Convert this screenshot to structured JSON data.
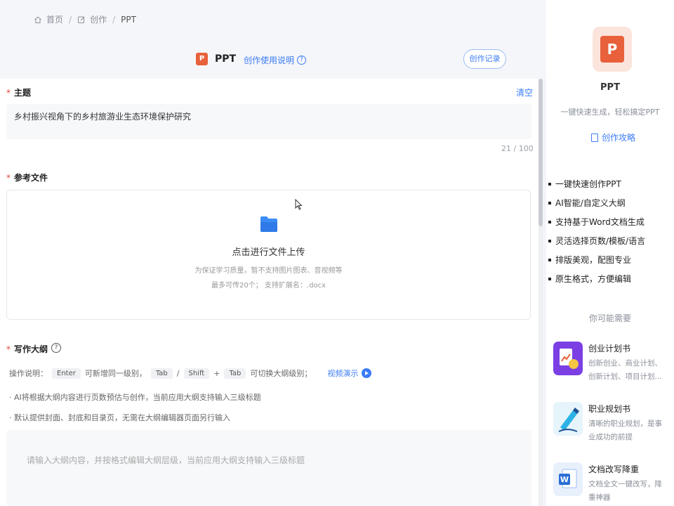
{
  "breadcrumb": {
    "home": "首页",
    "create": "创作",
    "current": "PPT"
  },
  "header": {
    "title": "PPT",
    "guide_link": "创作使用说明",
    "history_button": "创作记录"
  },
  "topic": {
    "label": "主题",
    "clear": "清空",
    "value": "乡村振兴视角下的乡村旅游业生态环境保护研究",
    "counter": "21 / 100"
  },
  "reference": {
    "label": "参考文件",
    "upload_title": "点击进行文件上传",
    "note1": "为保证学习质量，暂不支持图片图表、音视频等",
    "note2": "最多可传20个； 支持扩展名：.docx"
  },
  "outline": {
    "label": "写作大纲",
    "ops_label": "操作说明：",
    "key_enter": "Enter",
    "ops_text1": "可新增同一级别，",
    "key_tab": "Tab",
    "slash": "/",
    "key_shift": "Shift",
    "plus": "+",
    "key_tab2": "Tab",
    "ops_text2": "可切换大纲级别；",
    "video_link": "视频演示",
    "tip1": "· AI将根据大纲内容进行页数预估与创作，当前应用大纲支持输入三级标题",
    "tip2": "· 默认提供封面、封底和目录页，无需在大纲编辑器页面另行输入",
    "placeholder": "请输入大纲内容，并按格式编辑大纲层级，当前应用大纲支持输入三级标题"
  },
  "sidebar": {
    "title": "PPT",
    "subtitle": "一键快速生成，轻松搞定PPT",
    "guide": "创作攻略",
    "features": [
      "一键快速创作PPT",
      "AI智能/自定义大纲",
      "支持基于Word文档生成",
      "灵活选择页数/模板/语言",
      "排版美观，配图专业",
      "原生格式，方便编辑"
    ],
    "maybe_need": "你可能需要",
    "recommendations": [
      {
        "title": "创业计划书",
        "desc": "创新创业、商业计划、创新计划、项目计划...",
        "icon": "business-plan-icon",
        "color": "#7b3fe4"
      },
      {
        "title": "职业规划书",
        "desc": "清晰的职业规划，是事业成功的前提",
        "icon": "career-plan-icon",
        "color": "#2bb3e6"
      },
      {
        "title": "文档改写降重",
        "desc": "文档全文一键改写，降重神器",
        "icon": "word-rewrite-icon",
        "color": "#2b6fd6"
      }
    ]
  },
  "colors": {
    "accent": "#3b7cf6",
    "ppt_orange": "#e8613a",
    "required": "#e0453a"
  }
}
